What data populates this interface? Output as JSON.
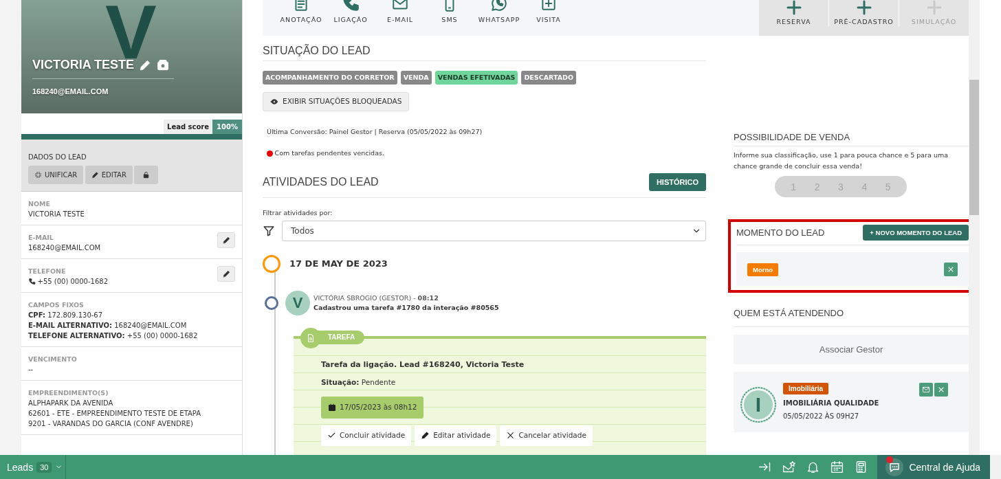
{
  "profile": {
    "avatar_letter": "V",
    "name": "VICTORIA TESTE",
    "email": "168240@EMAIL.COM",
    "lead_score": {
      "label": "Lead score",
      "value": "100%",
      "level": 1
    }
  },
  "lead_data": {
    "title": "DADOS DO LEAD",
    "buttons": [
      {
        "kind": "merge",
        "label": "UNIFICAR"
      },
      {
        "kind": "edit",
        "label": "EDITAR"
      },
      {
        "kind": "lock"
      }
    ],
    "fields": [
      {
        "label": "NOME",
        "lines": [
          "VICTORIA TESTE"
        ],
        "editable": false
      },
      {
        "label": "E-MAIL",
        "lines": [
          "168240@EMAIL.COM"
        ],
        "editable": true
      },
      {
        "label": "TELEFONE",
        "kind": "phone",
        "lines": [
          "+55 (00) 0000-1682"
        ],
        "editable": true
      },
      {
        "label": "CAMPOS FIXOS",
        "lines": [
          "**CPF:** 172.809.130-67",
          "**E-MAIL ALTERNATIVO:** 168240@EMAIL.COM",
          "**TELEFONE ALTERNATIVO:** +55 (00) 0000-1682"
        ],
        "editable": false
      },
      {
        "label": "VENCIMENTO",
        "lines": [
          "--"
        ],
        "editable": false
      },
      {
        "label": "EMPREENDIMENTO(S)",
        "lines": [
          "ALPHAPARK DA AVENIDA",
          "62601 - ETE - EMPREENDIMENTO TESTE DE ETAPA",
          "9201 - VARANDAS DO GARCIA (CONF AVENDRE)"
        ],
        "editable": false
      }
    ]
  },
  "toolbar": {
    "actions": [
      {
        "kind": "note",
        "label": "ANOTAÇÃO"
      },
      {
        "kind": "call",
        "label": "LIGAÇÃO"
      },
      {
        "kind": "mail",
        "label": "E-MAIL"
      },
      {
        "kind": "sms",
        "label": "SMS"
      },
      {
        "kind": "whatsapp",
        "label": "WHATSAPP"
      },
      {
        "kind": "visit",
        "label": "VISITA"
      }
    ],
    "quick": [
      {
        "label": "RESERVA",
        "disabled": false
      },
      {
        "label": "PRÉ-CADASTRO",
        "disabled": false
      },
      {
        "label": "SIMULAÇÃO",
        "disabled": true
      }
    ]
  },
  "situation": {
    "title": "SITUAÇÃO DO LEAD",
    "tags": [
      {
        "label": "ACOMPANHAMENTO DO CORRETOR",
        "selected": false
      },
      {
        "label": "VENDA",
        "selected": false
      },
      {
        "label": "VENDAS EFETIVADAS",
        "selected": true
      },
      {
        "label": "DESCARTADO",
        "selected": false
      }
    ],
    "button": "EXIBIR SITUAÇÕES BLOQUEADAS"
  },
  "last_conversion": "Última Conversão: Painel Gestor | Reserva (05/05/2022 às 09h27)",
  "alert": "Com tarefas pendentes vencidas.",
  "activities": {
    "title": "ATIVIDADES DO LEAD",
    "history_button": "HISTÓRICO",
    "filter_label": "Filtrar atividades por:",
    "filter_value": "Todos",
    "timeline": [
      {
        "date": "17 DE MAY DE 2023",
        "entries": [
          {
            "avatar_letter": "V",
            "author": "VICTÓRIA SBROGIO (GESTOR) - **08:12**",
            "text": "Cadastrou uma tarefa #1780 da interação #80565",
            "card": {
              "tag": "TAREFA",
              "title": "Tarefa da ligação. Lead #168240, Victoria Teste",
              "status": "**Situação:** Pendente",
              "due": "17/05/2023 às 08h12",
              "actions": [
                {
                  "kind": "check",
                  "label": "Concluir atividade"
                },
                {
                  "kind": "edit",
                  "label": "Editar atividade"
                },
                {
                  "kind": "cancel",
                  "label": "Cancelar atividade"
                }
              ]
            }
          }
        ]
      }
    ]
  },
  "sale_possibility": {
    "title": "POSSIBILIDADE DE VENDA",
    "hint": "Informe sua classificação, use 1 para pouca chance e 5 para uma chance grande de concluir essa venda!",
    "options": [
      {
        "label": "1",
        "selected": false
      },
      {
        "label": "2",
        "selected": false
      },
      {
        "label": "3",
        "selected": false
      },
      {
        "label": "4",
        "selected": false
      },
      {
        "label": "5",
        "selected": false
      }
    ]
  },
  "moment": {
    "title": "MOMENTO DO LEAD",
    "highlighted": true,
    "button": "+ NOVO MOMENTO DO LEAD",
    "items": [
      {
        "label": "Morno",
        "color": "#f57c00"
      }
    ]
  },
  "attending": {
    "title": "QUEM ESTÁ ATENDENDO",
    "associate": "Associar Gestor",
    "agents": [
      {
        "letter": "I",
        "tag": "Imobiliária",
        "color": "#d35400",
        "name": "IMOBILIÁRIA QUALIDADE",
        "date": "05/05/2022 ÀS 09H27"
      }
    ]
  },
  "footer": {
    "label": "Leads",
    "count": "30",
    "tools": [
      {
        "kind": "collapse"
      },
      {
        "kind": "mail-star"
      },
      {
        "kind": "bell"
      },
      {
        "kind": "calendar"
      },
      {
        "kind": "calculator"
      }
    ],
    "help": "Central de Ajuda",
    "notification": true
  }
}
